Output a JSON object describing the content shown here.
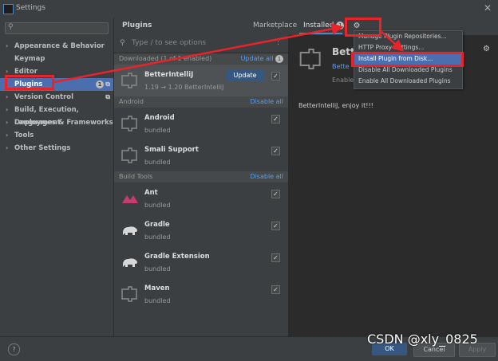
{
  "window": {
    "title": "Settings"
  },
  "sidebar": {
    "search_placeholder": "",
    "items": [
      {
        "label": "Appearance & Behavior",
        "arrow": "›"
      },
      {
        "label": "Keymap",
        "arrow": ""
      },
      {
        "label": "Editor",
        "arrow": "›"
      },
      {
        "label": "Plugins",
        "arrow": "",
        "badge": "1"
      },
      {
        "label": "Version Control",
        "arrow": "›"
      },
      {
        "label": "Build, Execution, Deployment",
        "arrow": "›"
      },
      {
        "label": "Languages & Frameworks",
        "arrow": "›"
      },
      {
        "label": "Tools",
        "arrow": "›"
      },
      {
        "label": "Other Settings",
        "arrow": "›"
      }
    ]
  },
  "header": {
    "title": "Plugins",
    "tab_marketplace": "Marketplace",
    "tab_installed": "Installed",
    "installed_badge": "1"
  },
  "plugin_list": {
    "search_placeholder": "Type / to see options",
    "sections": [
      {
        "title": "Downloaded (1 of 1 enabled)",
        "action": "Update all",
        "action_badge": "1"
      },
      {
        "title": "Android",
        "action": "Disable all"
      },
      {
        "title": "Build Tools",
        "action": "Disable all"
      }
    ],
    "plugins": [
      {
        "name": "BetterIntelliJ",
        "sub": "1.19 → 1.20  BetterIntelliJ",
        "button": "Update"
      },
      {
        "name": "Android",
        "sub": "bundled"
      },
      {
        "name": "Smali Support",
        "sub": "bundled"
      },
      {
        "name": "Ant",
        "sub": "bundled"
      },
      {
        "name": "Gradle",
        "sub": "bundled"
      },
      {
        "name": "Gradle Extension",
        "sub": "bundled"
      },
      {
        "name": "Maven",
        "sub": "bundled"
      }
    ]
  },
  "detail": {
    "name": "Bette",
    "link": "Bette",
    "status": "Enable",
    "description": "BetterIntelliJ, enjoy it!!!"
  },
  "gear_menu": {
    "items": [
      "Manage Plugin Repositories...",
      "HTTP Proxy Settings...",
      "Install Plugin from Disk...",
      "Disable All Downloaded Plugins",
      "Enable All Downloaded Plugins"
    ]
  },
  "footer": {
    "ok": "OK",
    "cancel": "Cancel",
    "apply": "Apply"
  },
  "watermark": "CSDN @xly_0825",
  "colors": {
    "accent": "#4b6eaf",
    "annotation": "#e8232a"
  }
}
